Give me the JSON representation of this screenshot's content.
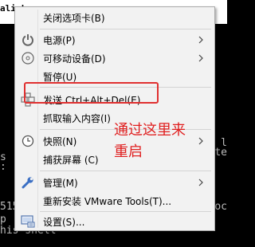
{
  "window": {
    "tab_title": "ali-L"
  },
  "terminal": {
    "lines_left": [
      "s",
      ":",
      "",
      "",
      "515",
      "p",
      "his shell"
    ],
    "lines_right": [
      "l",
      "te",
      "",
      "",
      "loc",
      "",
      ""
    ]
  },
  "menu": {
    "items": [
      {
        "label": "关闭选项卡(B)",
        "icon": "none",
        "submenu": false
      },
      {
        "label": "电源(P)",
        "icon": "power-icon",
        "submenu": true
      },
      {
        "label": "可移动设备(D)",
        "icon": "disc-icon",
        "submenu": true
      },
      {
        "label": "暂停(U)",
        "icon": "none",
        "submenu": false
      },
      {
        "label": "发送 Ctrl+Alt+Del(E)",
        "icon": "keyboard-send-icon",
        "submenu": false
      },
      {
        "label": "抓取输入内容(I)",
        "icon": "none",
        "submenu": false
      },
      {
        "label": "快照(N)",
        "icon": "snapshot-clock-icon",
        "submenu": true
      },
      {
        "label": "捕获屏幕 (C)",
        "icon": "none",
        "submenu": false
      },
      {
        "label": "管理(M)",
        "icon": "wrench-icon",
        "submenu": true
      },
      {
        "label": "重新安装 VMware Tools(T)...",
        "icon": "none",
        "submenu": false
      },
      {
        "label": "设置(S)...",
        "icon": "settings-icon",
        "submenu": false
      }
    ]
  },
  "annotation": {
    "text_line1": "通过这里来",
    "text_line2": "重启",
    "color": "#e02020"
  }
}
